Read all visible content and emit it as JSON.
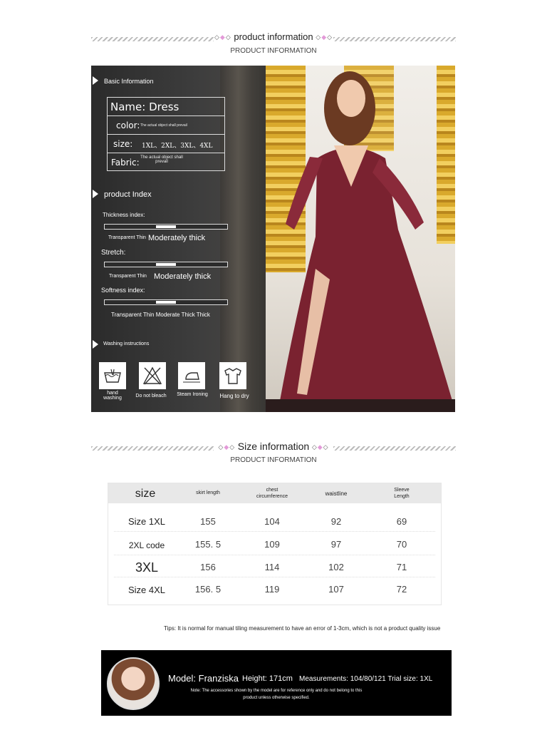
{
  "section1": {
    "title": "product information",
    "subtitle": "PRODUCT INFORMATION"
  },
  "basic": {
    "heading": "Basic Information",
    "name": "Name: Dress",
    "color_label": "color:",
    "color_value": "The actual object shall prevail",
    "size_label": "size:",
    "size_value": "1XL、2XL、3XL、4XL",
    "fabric_label": "Fabric:",
    "fabric_value_1": "The actual object shall",
    "fabric_value_2": "prevail"
  },
  "product_index": {
    "heading": "product Index",
    "thickness": {
      "label": "Thickness index:",
      "scale_left": "Transparent Thin",
      "scale_right": "Moderately thick",
      "level": 0.5
    },
    "stretch": {
      "label": "Stretch:",
      "scale_left": "Transparent Thin",
      "scale_right": "Moderately thick",
      "level": 0.5
    },
    "softness": {
      "label": "Softness index:",
      "scale": "Transparent Thin Moderate Thick Thick",
      "level": 0.5
    }
  },
  "washing": {
    "heading": "Washing instructions",
    "items": [
      {
        "icon": "hand-wash-icon",
        "label_1": "hand",
        "label_2": "washing"
      },
      {
        "icon": "no-bleach-icon",
        "label_1": "Do not bleach",
        "label_2": ""
      },
      {
        "icon": "iron-icon",
        "label_1": "Steam Ironing",
        "label_2": ""
      },
      {
        "icon": "hang-dry-icon",
        "label_1": "Hang to dry",
        "label_2": ""
      }
    ]
  },
  "section2": {
    "title": "Size information",
    "subtitle": "PRODUCT INFORMATION"
  },
  "size_table": {
    "headers": {
      "size": "size",
      "skirt": "skirt length",
      "chest_1": "chest",
      "chest_2": "circumference",
      "waist": "waistline",
      "sleeve_1": "Sleeve",
      "sleeve_2": "Length"
    },
    "rows": [
      {
        "size": "Size 1XL",
        "skirt": "155",
        "chest": "104",
        "waist": "92",
        "sleeve": "69"
      },
      {
        "size": "2XL code",
        "skirt": "155. 5",
        "chest": "109",
        "waist": "97",
        "sleeve": "70"
      },
      {
        "size": "3XL",
        "skirt": "156",
        "chest": "114",
        "waist": "102",
        "sleeve": "71"
      },
      {
        "size": "Size 4XL",
        "skirt": "156. 5",
        "chest": "119",
        "waist": "107",
        "sleeve": "72"
      }
    ]
  },
  "tips": "Tips: It is normal for manual tiling measurement to have an error of 1-3cm, which is not a product quality issue",
  "model": {
    "name": "Model: Franziska",
    "height": "Height: 171cm",
    "measurements": "Measurements: 104/80/121 Trial size: 1XL",
    "note_1": "Note: The accessories shown by the model are for reference only and do not belong to this",
    "note_2": "product unless otherwise specified."
  },
  "colors": {
    "panel": "#2b2b2b",
    "dress": "#7a2230",
    "gold": "#d9a92c",
    "diamond_pink": "#e39ad8"
  }
}
